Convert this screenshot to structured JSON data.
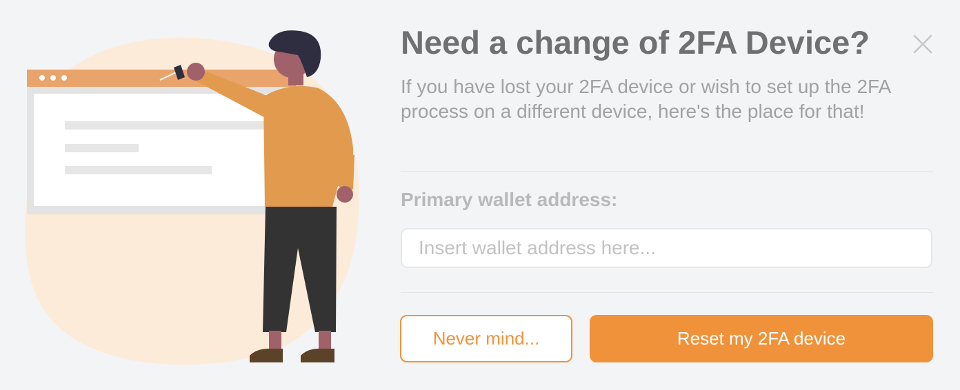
{
  "dialog": {
    "title": "Need a change of 2FA Device?",
    "description": "If you have lost your 2FA device or wish to set up the 2FA process on a different device, here's the place for that!",
    "close_icon": "close-icon",
    "wallet_label": "Primary wallet address:",
    "wallet_input": {
      "value": "",
      "placeholder": "Insert wallet address here..."
    },
    "cancel_label": "Never mind...",
    "submit_label": "Reset my 2FA device"
  },
  "colors": {
    "accent": "#f0923a",
    "background": "#f3f4f6",
    "title": "#707070",
    "text_muted": "#a2a2a2"
  }
}
